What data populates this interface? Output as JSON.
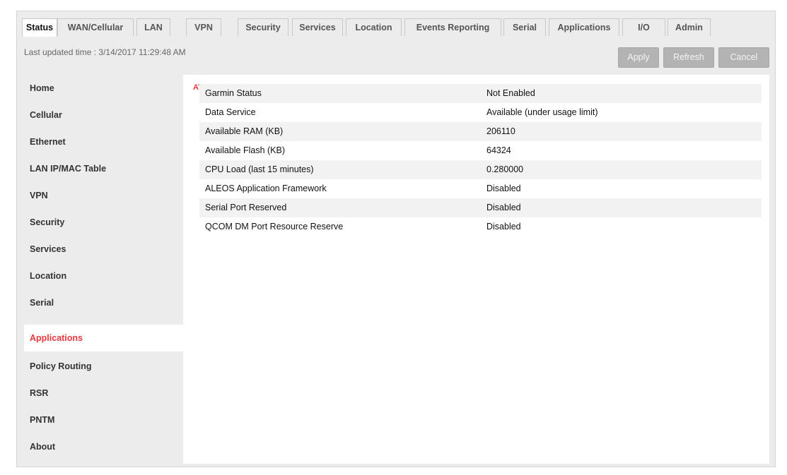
{
  "tabs": [
    {
      "label": "Status",
      "active": true
    },
    {
      "label": "WAN/Cellular"
    },
    {
      "label": "LAN"
    },
    {
      "label": "VPN"
    },
    {
      "label": "Security"
    },
    {
      "label": "Services"
    },
    {
      "label": "Location"
    },
    {
      "label": "Events Reporting"
    },
    {
      "label": "Serial"
    },
    {
      "label": "Applications"
    },
    {
      "label": "I/O"
    },
    {
      "label": "Admin"
    }
  ],
  "header": {
    "last_updated": "Last updated time : 3/14/2017 11:29:48 AM",
    "apply_label": "Apply",
    "refresh_label": "Refresh",
    "cancel_label": "Cancel"
  },
  "sidebar": {
    "items": [
      {
        "label": "Home"
      },
      {
        "label": "Cellular"
      },
      {
        "label": "Ethernet"
      },
      {
        "label": "LAN IP/MAC Table"
      },
      {
        "label": "VPN"
      },
      {
        "label": "Security"
      },
      {
        "label": "Services"
      },
      {
        "label": "Location"
      },
      {
        "label": "Serial"
      },
      {
        "label": "Applications",
        "active": true
      },
      {
        "label": "Policy Routing"
      },
      {
        "label": "RSR"
      },
      {
        "label": "PNTM"
      },
      {
        "label": "About"
      }
    ]
  },
  "main": {
    "at_marker": "AT",
    "rows": [
      {
        "label": "Garmin Status",
        "value": "Not Enabled"
      },
      {
        "label": "Data Service",
        "value": "Available (under usage limit)"
      },
      {
        "label": "Available RAM (KB)",
        "value": "206110"
      },
      {
        "label": "Available Flash (KB)",
        "value": "64324"
      },
      {
        "label": "CPU Load (last 15 minutes)",
        "value": "0.280000"
      },
      {
        "label": "ALEOS Application Framework",
        "value": "Disabled"
      },
      {
        "label": "Serial Port Reserved",
        "value": "Disabled"
      },
      {
        "label": "QCOM DM Port Resource Reserve",
        "value": "Disabled"
      }
    ]
  },
  "colors": {
    "accent": "#e8383d",
    "button_bg": "#b3b3b3",
    "frame_bg": "#ececec"
  }
}
